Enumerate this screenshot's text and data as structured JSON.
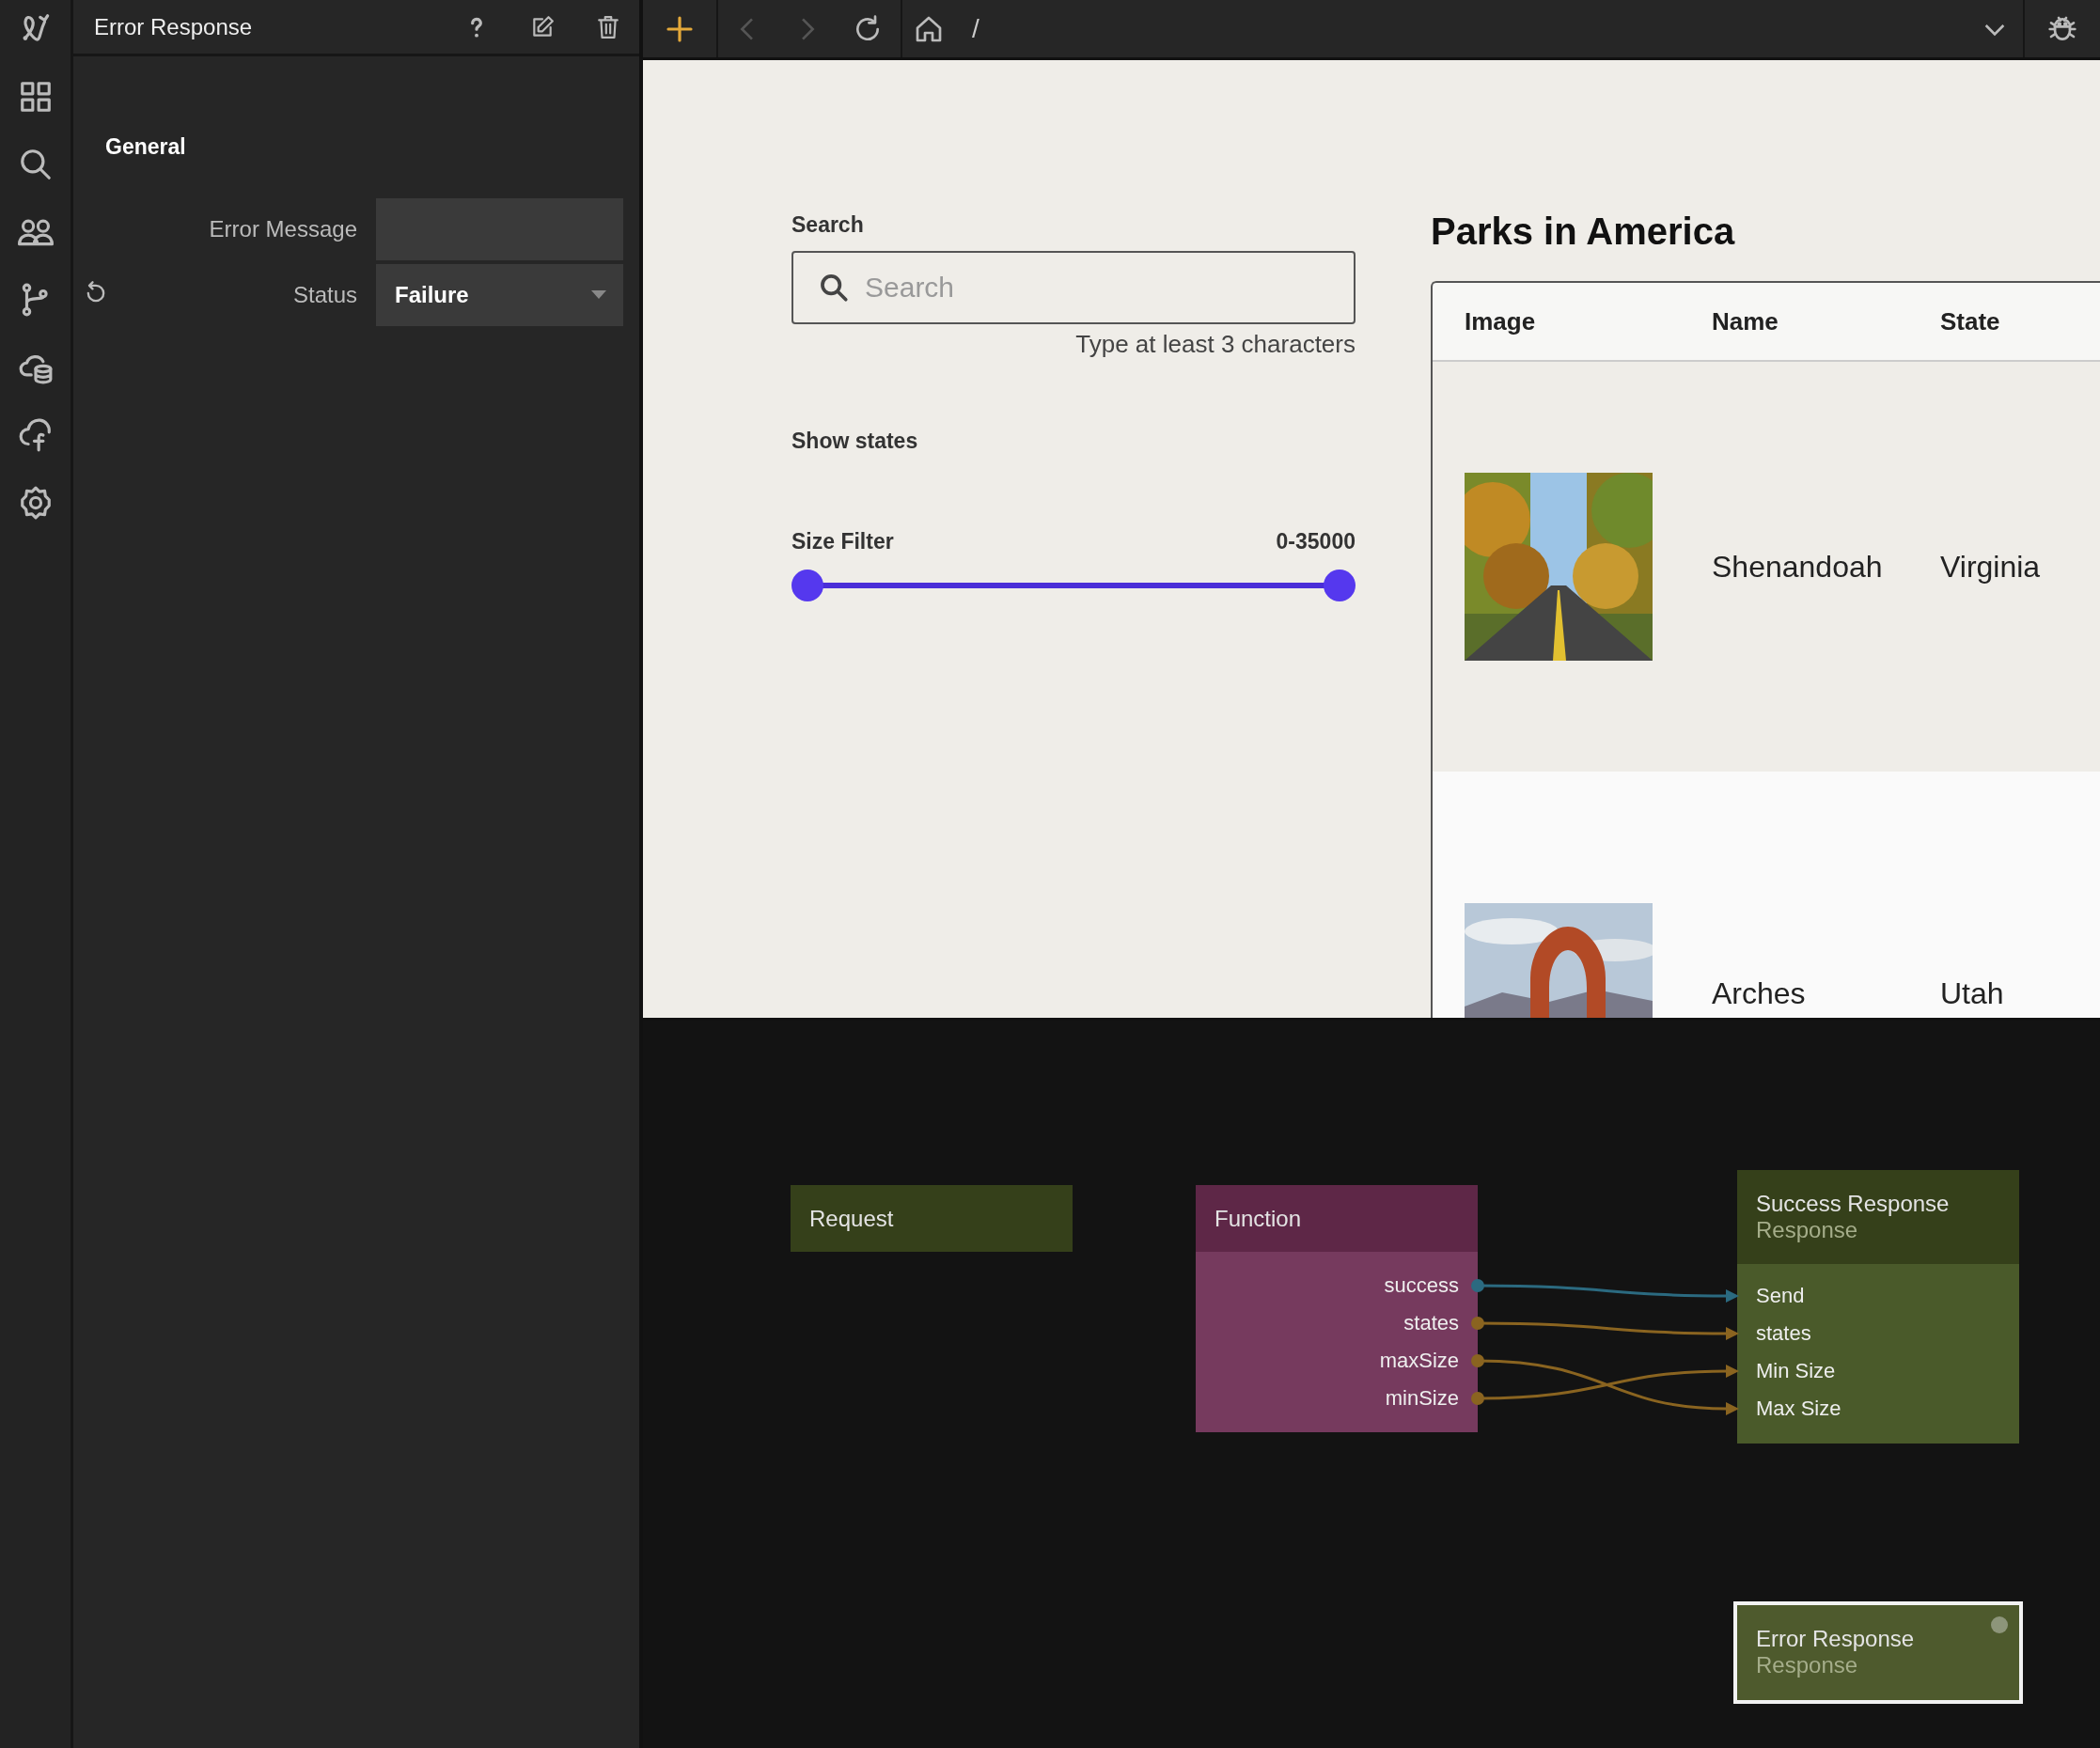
{
  "panel": {
    "title": "Error Response",
    "section": "General",
    "fields": [
      {
        "kind": "text",
        "label": "Error Message",
        "resettable": false
      },
      {
        "kind": "select",
        "label": "Status",
        "value": "Failure",
        "resettable": true
      }
    ]
  },
  "toolbar": {
    "path": "/"
  },
  "preview": {
    "search": {
      "label": "Search",
      "placeholder": "Search",
      "hint": "Type at least 3 characters"
    },
    "show_states": {
      "label": "Show states"
    },
    "size_filter": {
      "label": "Size Filter",
      "reading": "0-35000",
      "thumbs": [
        {
          "level": 0
        },
        {
          "level": 1
        }
      ]
    },
    "parks": {
      "title": "Parks in America",
      "columns": [
        "Image",
        "Name",
        "State"
      ],
      "rows": [
        {
          "name": "Shenandoah",
          "state": "Virginia"
        },
        {
          "name": "Arches",
          "state": "Utah"
        }
      ]
    }
  },
  "canvas": {
    "nodes": [
      {
        "kind": "request",
        "title": "Request",
        "selected": false
      },
      {
        "kind": "function",
        "title": "Function",
        "selected": false,
        "outputs": [
          {
            "label": "success",
            "wire": {
              "crossed": false,
              "color": "#2b6a80"
            }
          },
          {
            "label": "states",
            "wire": {
              "crossed": false,
              "color": "#8a6420"
            }
          },
          {
            "label": "maxSize",
            "wire": {
              "crossed": true,
              "color": "#8a6420"
            }
          },
          {
            "label": "minSize",
            "wire": {
              "crossed": true,
              "color": "#8a6420"
            }
          }
        ]
      },
      {
        "kind": "response",
        "title": "Success Response",
        "subtitle": "Response",
        "selected": false,
        "inputs": [
          "Send",
          "states",
          "Min Size",
          "Max Size"
        ]
      },
      {
        "kind": "response",
        "title": "Error Response",
        "subtitle": "Response",
        "selected": true
      }
    ]
  }
}
